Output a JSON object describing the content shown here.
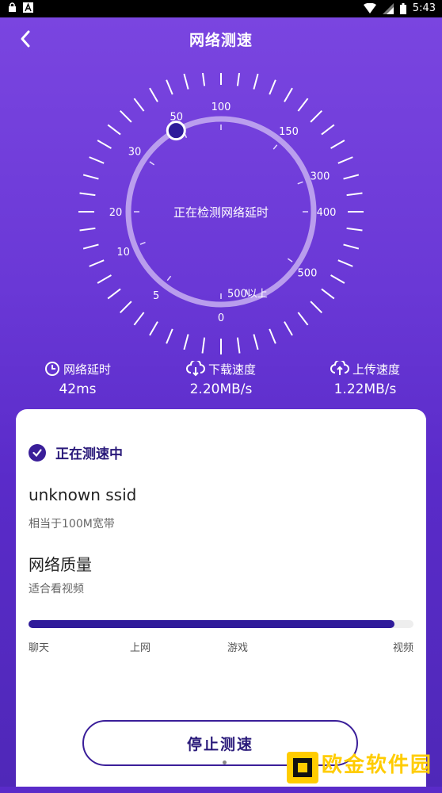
{
  "status_bar": {
    "time": "5:43"
  },
  "header": {
    "title": "网络测速"
  },
  "gauge": {
    "center_text": "正在检测网络延时",
    "scale_labels": [
      "0",
      "5",
      "10",
      "20",
      "30",
      "50",
      "100",
      "150",
      "300",
      "400",
      "500",
      "500以上"
    ],
    "indicator_value": 50
  },
  "stats": {
    "latency": {
      "label": "网络延时",
      "value": "42ms"
    },
    "download": {
      "label": "下载速度",
      "value": "2.20MB/s"
    },
    "upload": {
      "label": "上传速度",
      "value": "1.22MB/s"
    }
  },
  "card": {
    "status": "正在测速中",
    "ssid": "unknown ssid",
    "bandwidth": "相当于100M宽带",
    "quality_title": "网络质量",
    "quality_desc": "适合看视频",
    "quality_level": 0.95,
    "quality_labels": [
      "聊天",
      "上网",
      "游戏",
      "视频"
    ],
    "stop_button": "停止测速"
  },
  "watermark": {
    "text": "欧金软件园",
    "url": "www.apoujin.com"
  },
  "colors": {
    "accent": "#3a1e99",
    "header_bg": "#7a45e0"
  }
}
